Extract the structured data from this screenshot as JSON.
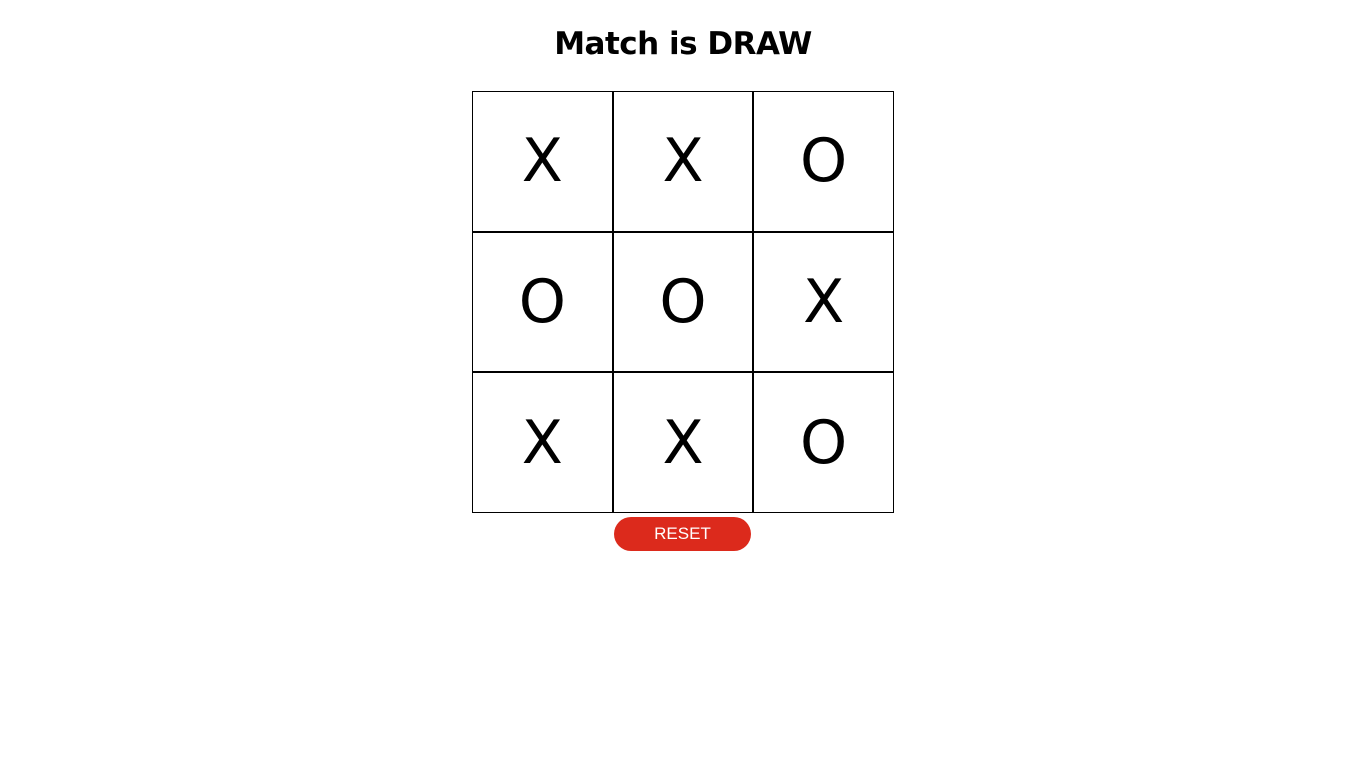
{
  "status": {
    "message": "Match is DRAW"
  },
  "board": {
    "cells": [
      "X",
      "X",
      "O",
      "O",
      "O",
      "X",
      "X",
      "X",
      "O"
    ]
  },
  "controls": {
    "reset_label": "RESET"
  },
  "colors": {
    "reset_button": "#dc2a1c",
    "grid_lines": "#000000",
    "background": "#ffffff"
  }
}
